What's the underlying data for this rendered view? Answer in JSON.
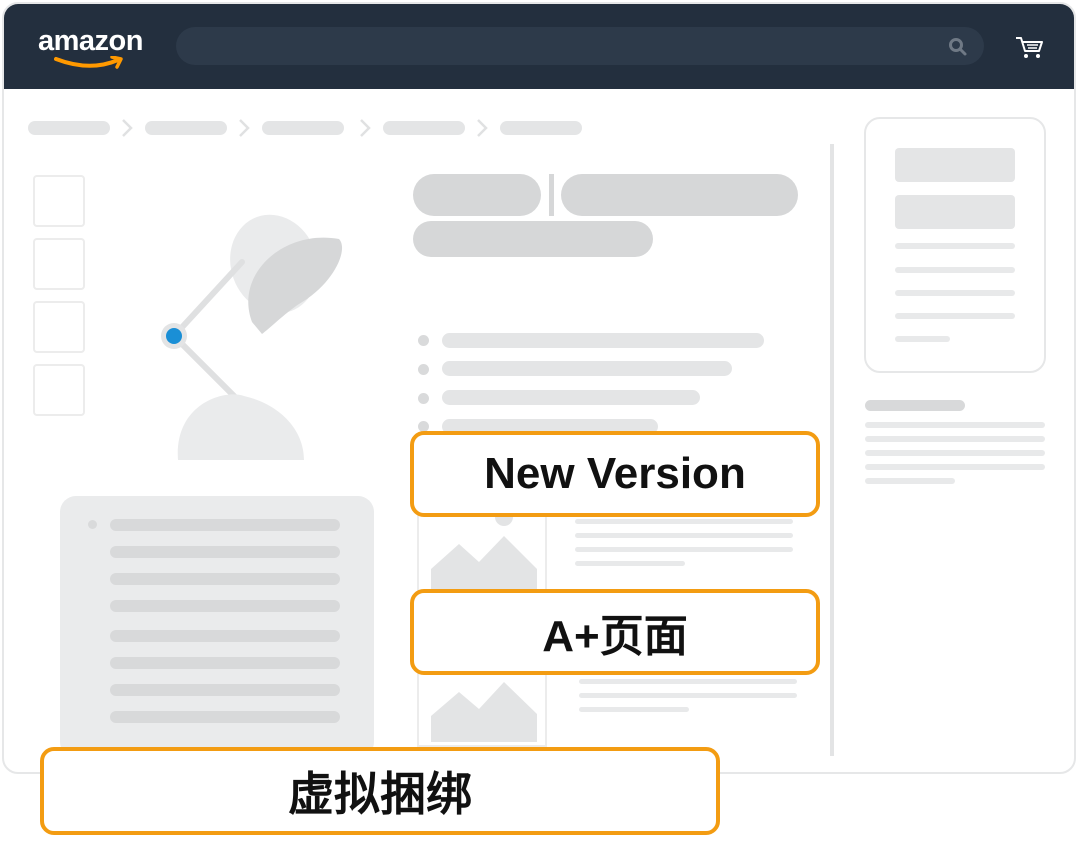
{
  "header": {
    "logo_text": "amazon",
    "search_icon": "search-icon",
    "cart_icon": "cart-icon"
  },
  "overlays": {
    "new_version_label": "New Version",
    "aplus_label": "A+页面",
    "bundle_label": "虚拟捆绑"
  },
  "colors": {
    "topbar": "#232f3e",
    "accent_orange": "#f39c12",
    "pivot_blue": "#1a8fd6",
    "placeholder_gray": "#e4e5e6"
  }
}
